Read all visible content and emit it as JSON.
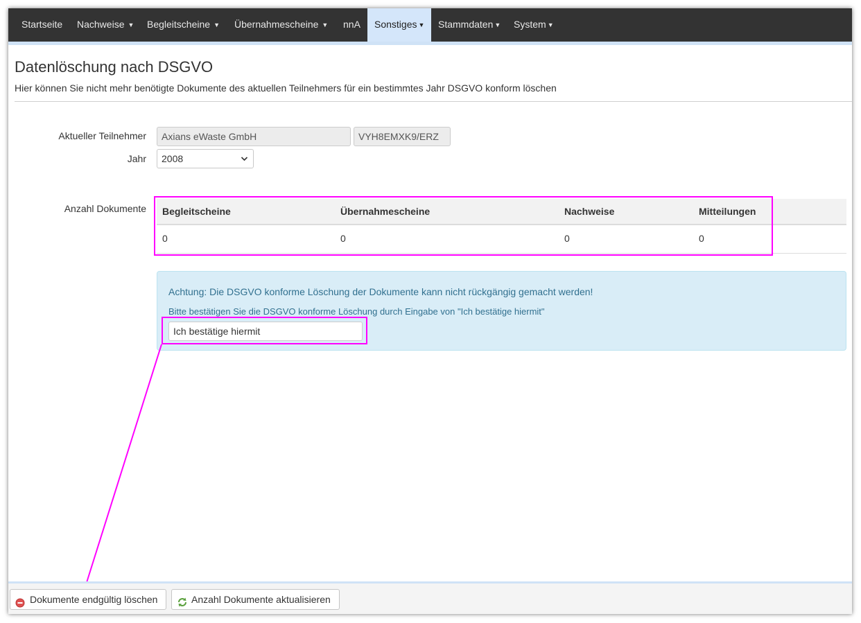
{
  "nav": {
    "items": [
      {
        "label": "Startseite",
        "dropdown": false
      },
      {
        "label": "Nachweise",
        "dropdown": true
      },
      {
        "label": "Begleitscheine",
        "dropdown": true
      },
      {
        "label": "Übernahmescheine",
        "dropdown": true
      },
      {
        "label": "nnA",
        "dropdown": false
      },
      {
        "label": "Sonstiges",
        "dropdown": true,
        "active": true
      },
      {
        "label": "Stammdaten",
        "dropdown": true
      },
      {
        "label": "System",
        "dropdown": true
      }
    ]
  },
  "header": {
    "title": "Datenlöschung nach DSGVO",
    "subtitle": "Hier können Sie nicht mehr benötigte Dokumente des aktuellen Teilnehmers für ein bestimmtes Jahr DSGVO konform löschen"
  },
  "form": {
    "participant_label": "Aktueller Teilnehmer",
    "participant_name": "Axians eWaste GmbH",
    "participant_id": "VYH8EMXK9/ERZ",
    "year_label": "Jahr",
    "year_value": "2008",
    "documents_label": "Anzahl Dokumente"
  },
  "documents_table": {
    "columns": [
      "Begleitscheine",
      "Übernahmescheine",
      "Nachweise",
      "Mitteilungen"
    ],
    "values": [
      "0",
      "0",
      "0",
      "0"
    ]
  },
  "alert": {
    "warning": "Achtung: Die DSGVO konforme Löschung der Dokumente kann nicht rückgängig gemacht werden!",
    "instruction": "Bitte bestätigen Sie die DSGVO konforme Löschung durch Eingabe von \"Ich bestätige hiermit\"",
    "confirm_value": "Ich bestätige hiermit"
  },
  "footer": {
    "delete_button": "Dokumente endgültig löschen",
    "refresh_button": "Anzahl Dokumente aktualisieren"
  },
  "colors": {
    "navbar": "#333333",
    "nav_active": "#d4e6fa",
    "alert_bg": "#d9edf7",
    "alert_text": "#31708f",
    "annotation": "#ff00ff"
  }
}
